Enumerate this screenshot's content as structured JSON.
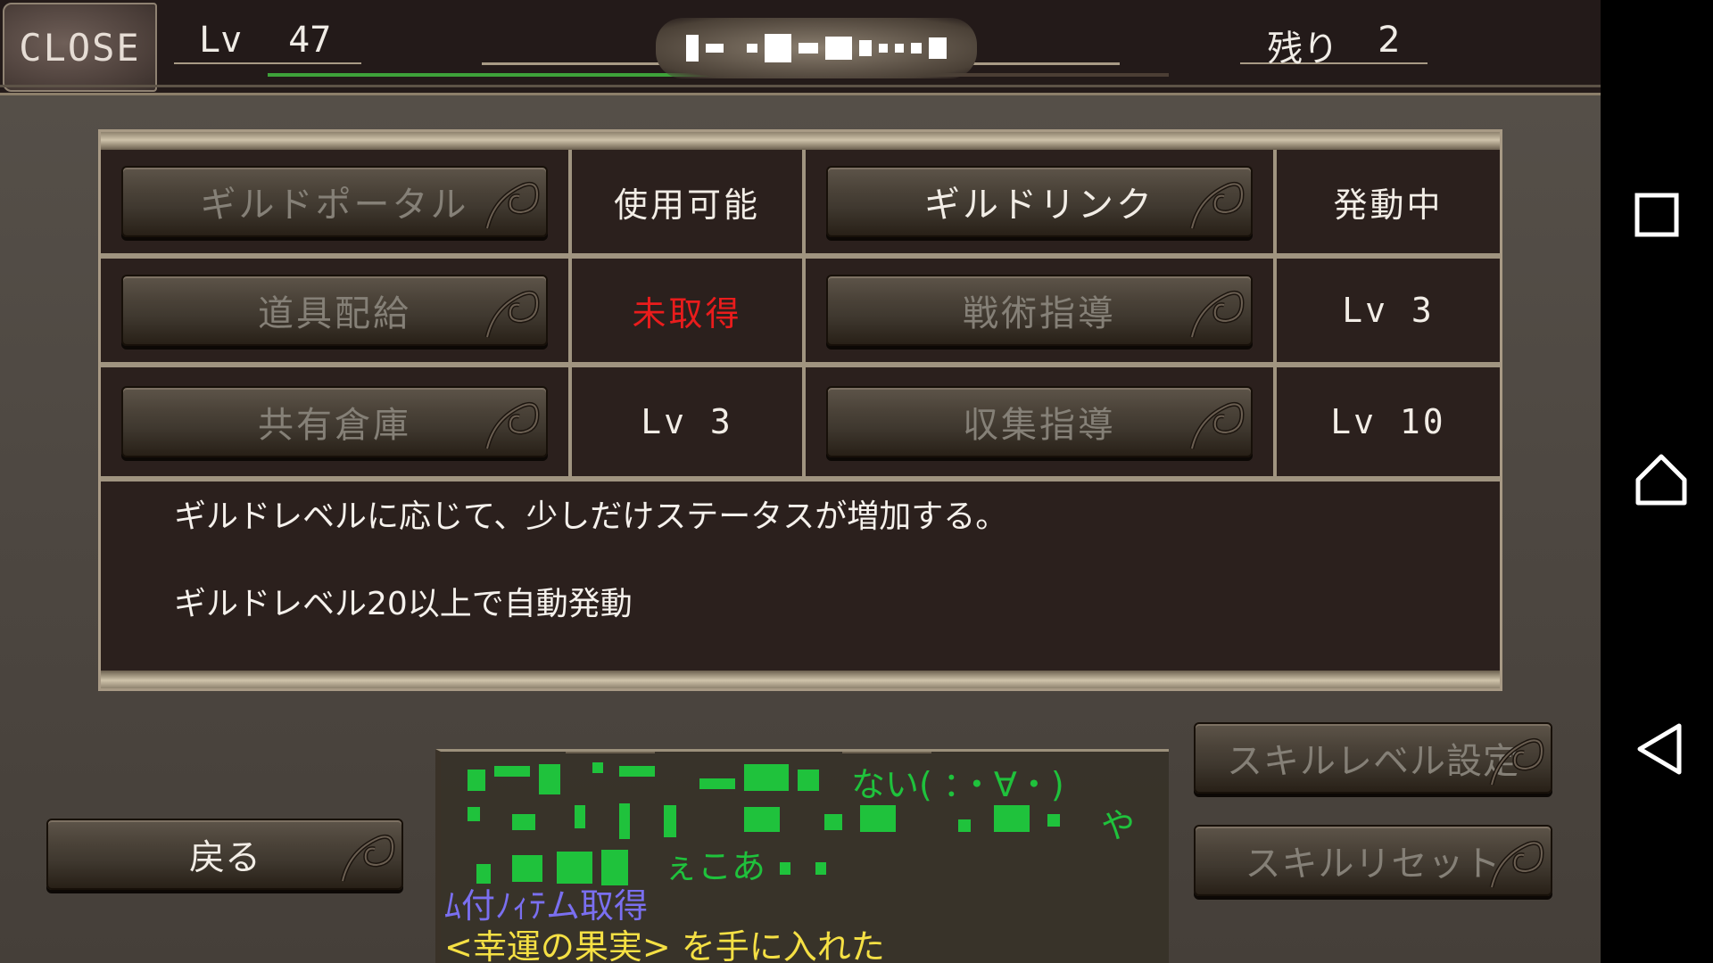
{
  "topbar": {
    "close_label": "CLOSE",
    "level_label": "Lv",
    "level_value": "47",
    "remaining_label": "残り",
    "remaining_value": "2",
    "exp_progress": 0.52
  },
  "skills": [
    {
      "name": "ギルドポータル",
      "status": "使用可能",
      "status_color": "#f2ede6",
      "available": false
    },
    {
      "name": "ギルドリンク",
      "status": "発動中",
      "status_color": "#f2ede6",
      "available": true
    },
    {
      "name": "道具配給",
      "status": "未取得",
      "status_color": "#ea1c1c",
      "available": false
    },
    {
      "name": "戦術指導",
      "status": "Lv  3",
      "status_color": "#f2ede6",
      "available": false
    },
    {
      "name": "共有倉庫",
      "status": "Lv  3",
      "status_color": "#f2ede6",
      "available": false
    },
    {
      "name": "収集指導",
      "status": "Lv  10",
      "status_color": "#f2ede6",
      "available": false
    }
  ],
  "description": {
    "line1": "ギルドレベルに応じて、少しだけステータスが増加する。",
    "line2": "ギルドレベル20以上で自動発動"
  },
  "buttons": {
    "back": "戻る",
    "skill_level_settings": "スキルレベル設定",
    "skill_reset": "スキルリセット"
  },
  "chat": {
    "line1_tail": "ない( ：・∀・)",
    "line2_tail": "や",
    "line3_tail": "ぇこあ",
    "line4": "ﾑ付ﾉｨﾃム取得",
    "line5": "<幸運の果実>  を手に入れた",
    "line4_color": "#7a6ff0",
    "line5_color": "#f5e044",
    "noise_color": "#1fc23c"
  },
  "navbar": {
    "recent_icon": "square-icon",
    "home_icon": "home-icon",
    "back_icon": "back-triangle-icon"
  }
}
